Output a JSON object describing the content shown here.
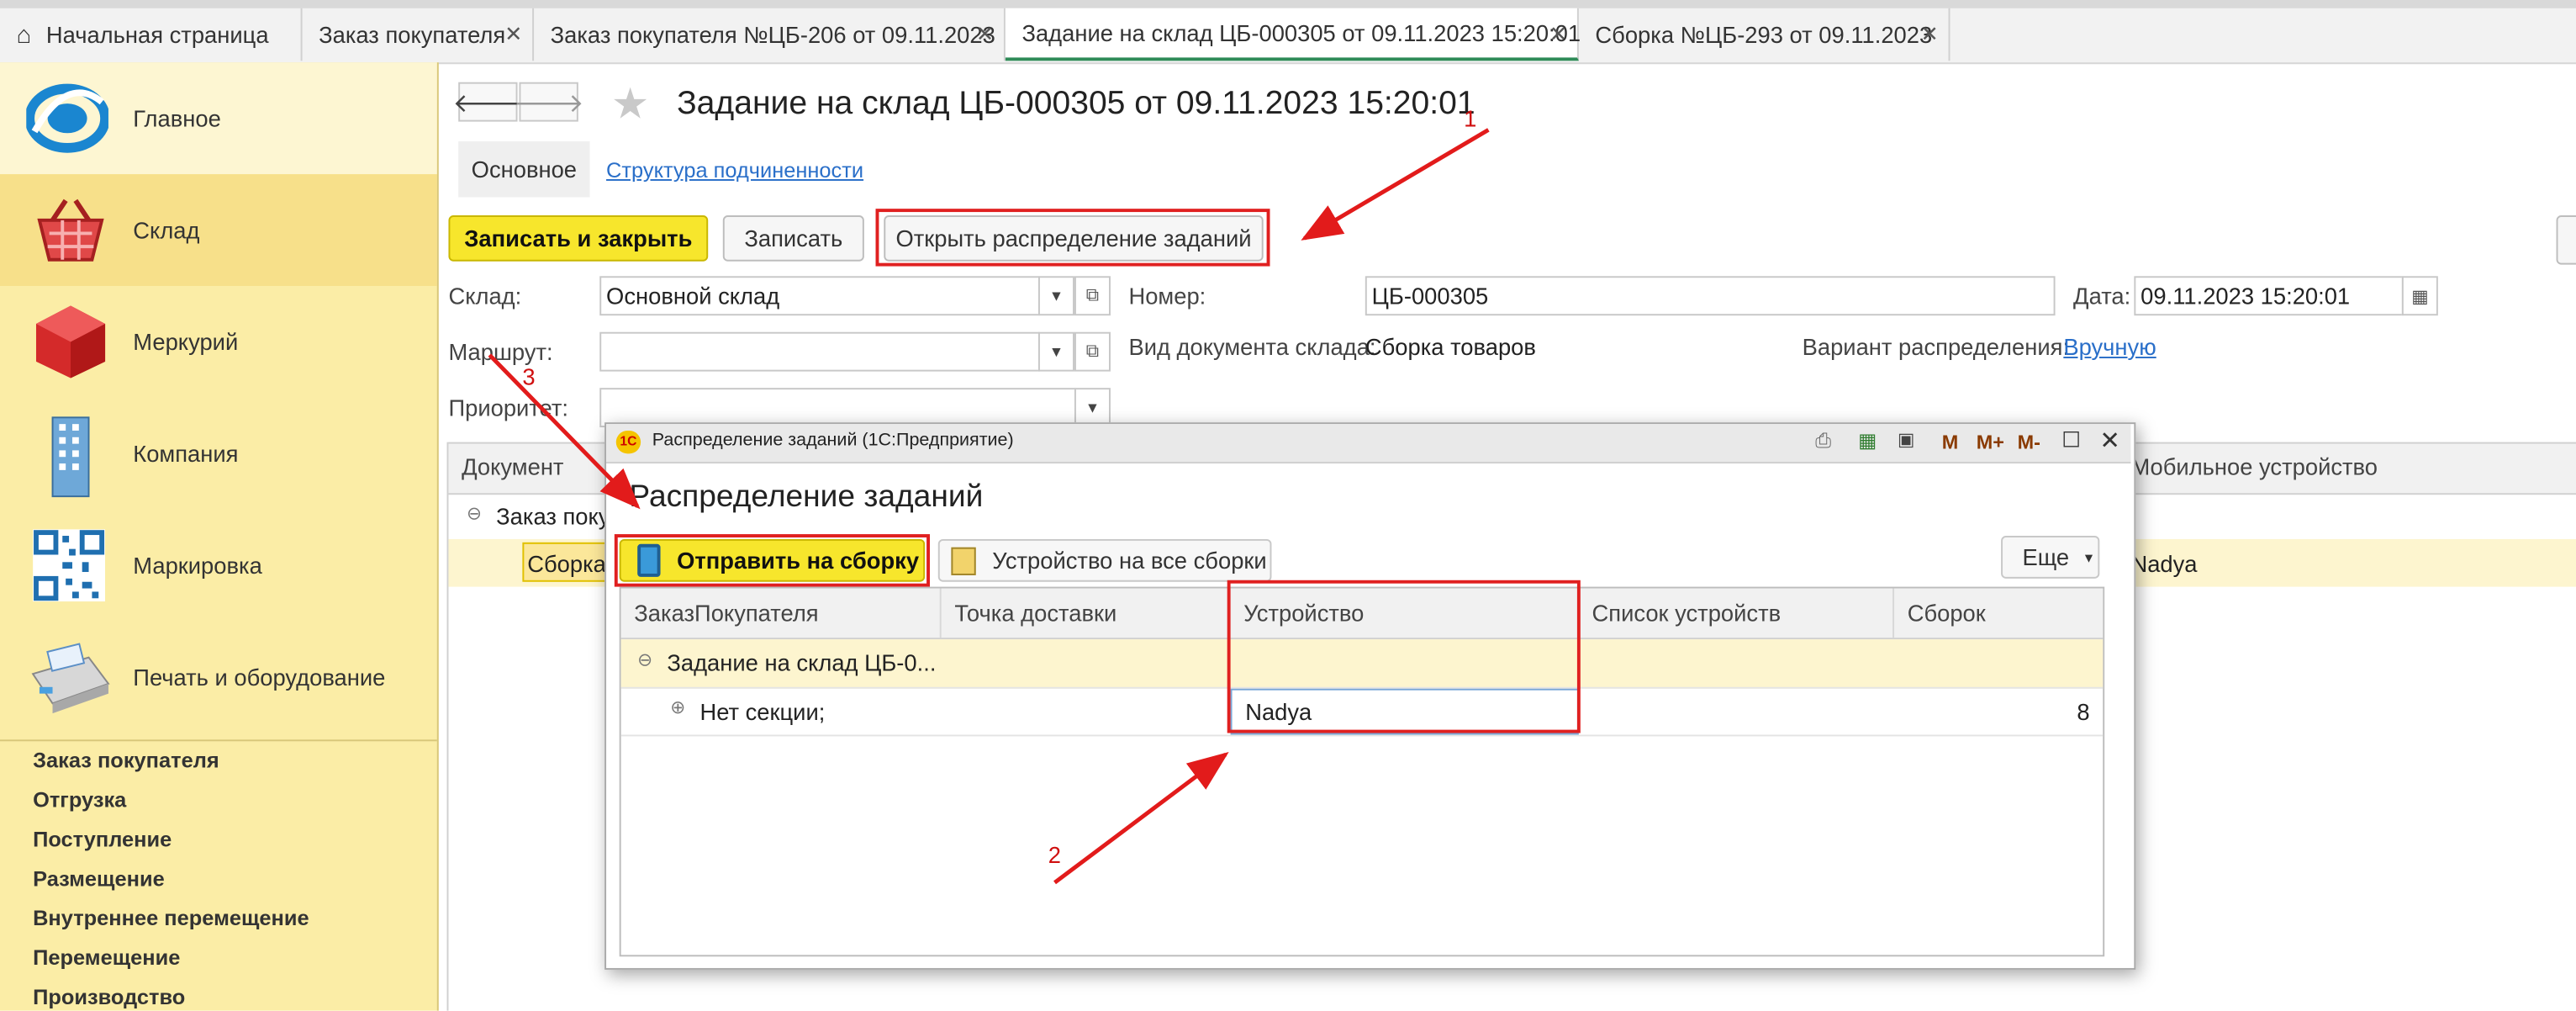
{
  "tabs": [
    {
      "label": "Начальная страница",
      "closable": false
    },
    {
      "label": "Заказ покупателя",
      "closable": true
    },
    {
      "label": "Заказ покупателя №ЦБ-206 от 09.11.2023",
      "closable": true
    },
    {
      "label": "Задание на склад ЦБ-000305 от 09.11.2023 15:20:01",
      "closable": true,
      "active": true
    },
    {
      "label": "Сборка №ЦБ-293 от 09.11.2023",
      "closable": true
    }
  ],
  "sidebar": {
    "sections": [
      {
        "label": "Главное",
        "icon": "app-logo-icon"
      },
      {
        "label": "Склад",
        "icon": "warehouse-basket-icon"
      },
      {
        "label": "Меркурий",
        "icon": "red-cube-icon"
      },
      {
        "label": "Компания",
        "icon": "building-icon"
      },
      {
        "label": "Маркировка",
        "icon": "qr-code-icon"
      },
      {
        "label": "Печать и оборудование",
        "icon": "pos-terminal-icon"
      }
    ],
    "links": [
      "Заказ покупателя",
      "Отгрузка",
      "Поступление",
      "Размещение",
      "Внутреннее перемещение",
      "Перемещение",
      "Производство"
    ]
  },
  "form": {
    "title": "Задание на склад ЦБ-000305 от 09.11.2023 15:20:01",
    "subtabs": {
      "main": "Основное",
      "structure": "Структура подчиненности"
    },
    "buttons": {
      "save_close": "Записать и закрыть",
      "save": "Записать",
      "open_distribution": "Открыть распределение заданий"
    },
    "fields": {
      "warehouse_label": "Склад:",
      "warehouse_value": "Основной склад",
      "route_label": "Маршрут:",
      "route_value": "",
      "priority_label": "Приоритет:",
      "priority_value": "",
      "number_label": "Номер:",
      "number_value": "ЦБ-000305",
      "date_label": "Дата:",
      "date_value": "09.11.2023 15:20:01",
      "doc_type_label": "Вид документа склада:",
      "doc_type_value": "Сборка товаров",
      "distribution_label": "Вариант распределения:",
      "distribution_value": "Вручную"
    },
    "table": {
      "col_document": "Документ",
      "col_mobile": "Мобильное устройство",
      "group_row": "Заказ покупа",
      "row_doc": "Сборка",
      "row_mobile": "Nadya"
    }
  },
  "dialog": {
    "window_title": "Распределение заданий  (1С:Предприятие)",
    "heading": "Распределение заданий",
    "toolbar": {
      "send": "Отправить на сборку",
      "device_all": "Устройство на все сборки",
      "more": "Еще"
    },
    "title_icons": [
      "M",
      "M+",
      "M-"
    ],
    "columns": [
      "ЗаказПокупателя",
      "Точка доставки",
      "Устройство",
      "Список устройств",
      "Сборок"
    ],
    "rows": [
      {
        "order": "Задание на склад ЦБ-0...",
        "point": "",
        "device": "",
        "device_list": "",
        "count": ""
      },
      {
        "order": "Нет секции;",
        "point": "",
        "device": "Nadya",
        "device_list": "",
        "count": "8"
      }
    ]
  },
  "annotations": [
    "1",
    "2",
    "3"
  ]
}
